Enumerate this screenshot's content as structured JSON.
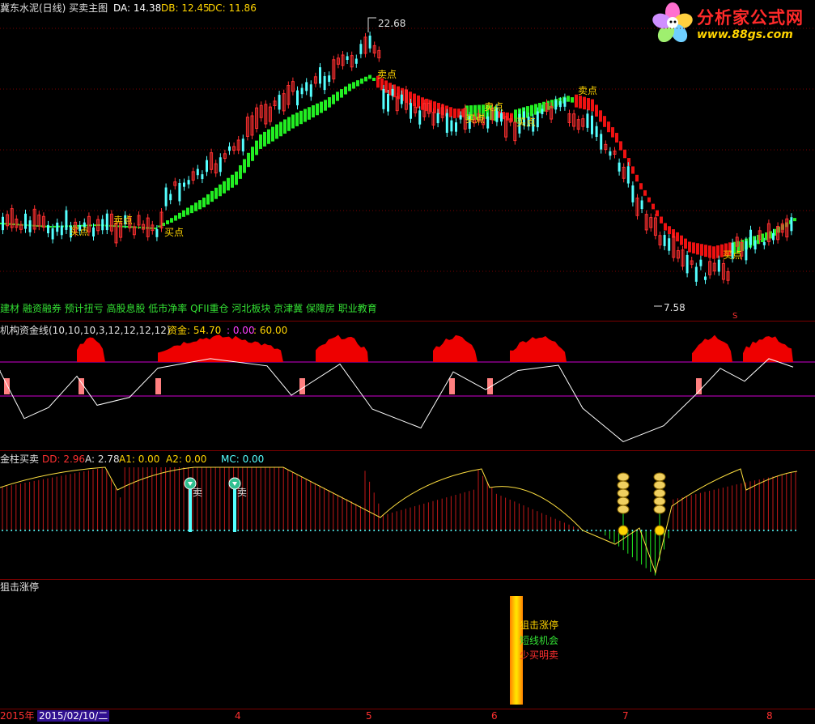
{
  "header": {
    "title": "冀东水泥(日线) 买卖主图",
    "da": "DA: 14.38",
    "db": "DB: 12.45",
    "dc": "DC: 11.86"
  },
  "logo": {
    "name": "分析家公式网",
    "url": "www.88gs.com"
  },
  "main": {
    "high_label": "22.68",
    "low_label": "7.58",
    "s_marker": "S",
    "signals": [
      {
        "text": "买点",
        "color": "#ffd400"
      },
      {
        "text": "卖点",
        "color": "#ffd400"
      },
      {
        "text": "买点",
        "color": "#ffd400"
      },
      {
        "text": "卖点",
        "color": "#ffd400"
      },
      {
        "text": "买点",
        "color": "#ffd400"
      },
      {
        "text": "卖点",
        "color": "#ffd400"
      },
      {
        "text": "买点",
        "color": "#ffd400"
      },
      {
        "text": "卖点",
        "color": "#ffd400"
      },
      {
        "text": "买点",
        "color": "#ffd400"
      }
    ],
    "concepts": "建材 融资融券 预计扭亏 高股息股 低市净率 QFII重仓 河北板块 京津冀 保障房 职业教育"
  },
  "panel2": {
    "title": "机构资金线(10,10,10,3,12,12,12,12)",
    "zijin_label": "资金: 54.70",
    "v1": ": 0.00",
    "v2": ": 60.00"
  },
  "panel3": {
    "title": "金柱买卖",
    "dd": "DD: 2.96",
    "a": "A: 2.78",
    "a1": "A1: 0.00",
    "a2": "A2: 0.00",
    "mc": "MC: 0.00",
    "sell_text": "卖"
  },
  "panel4": {
    "title": "狙击涨停",
    "lines": [
      "狙击涨停",
      "短线机会",
      "少买明卖"
    ]
  },
  "date_axis": {
    "year": "2015年",
    "current_date": "2015/02/10/二",
    "months": [
      "4",
      "5",
      "6",
      "7",
      "8"
    ]
  },
  "colors": {
    "up": "#ff3030",
    "down": "#54ffff",
    "ribbon_up": "#22ee22",
    "ribbon_down": "#ee1111",
    "signal": "#ffd400",
    "magenta": "#d000d0",
    "pink": "#ff8080"
  }
}
